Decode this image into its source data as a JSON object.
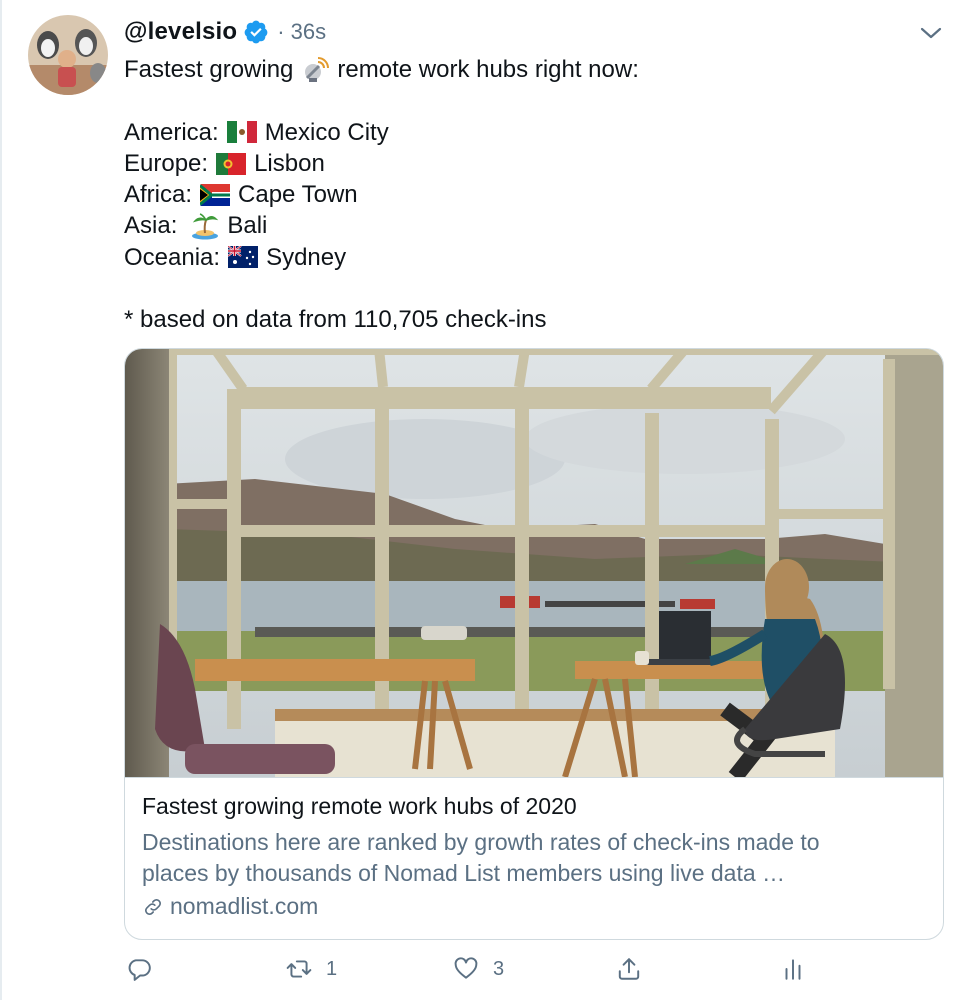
{
  "tweet": {
    "handle": "@levelsio",
    "separator": "·",
    "time": "36s",
    "intro_before": "Fastest growing",
    "intro_after": "remote work hubs right now:",
    "regions": [
      {
        "label": "America:",
        "city": "Mexico City",
        "icon": "mexico-flag"
      },
      {
        "label": "Europe:",
        "city": "Lisbon",
        "icon": "portugal-flag"
      },
      {
        "label": "Africa:",
        "city": "Cape Town",
        "icon": "south-africa-flag"
      },
      {
        "label": "Asia:",
        "city": "Bali",
        "icon": "island-emoji"
      },
      {
        "label": "Oceania:",
        "city": "Sydney",
        "icon": "australia-flag"
      }
    ],
    "footnote": "* based on data from 110,705 check-ins"
  },
  "card": {
    "title": "Fastest growing remote work hubs of 2020",
    "description_line1": "Destinations here are ranked by growth rates of check-ins made to",
    "description_line2": "places by thousands of Nomad List members using live data …",
    "domain": "nomadlist.com"
  },
  "actions": {
    "reply_count": "",
    "retweet_count": "1",
    "like_count": "3"
  },
  "colors": {
    "verified": "#1d9bf0",
    "muted": "#5b7083",
    "border": "#cfd9de"
  }
}
